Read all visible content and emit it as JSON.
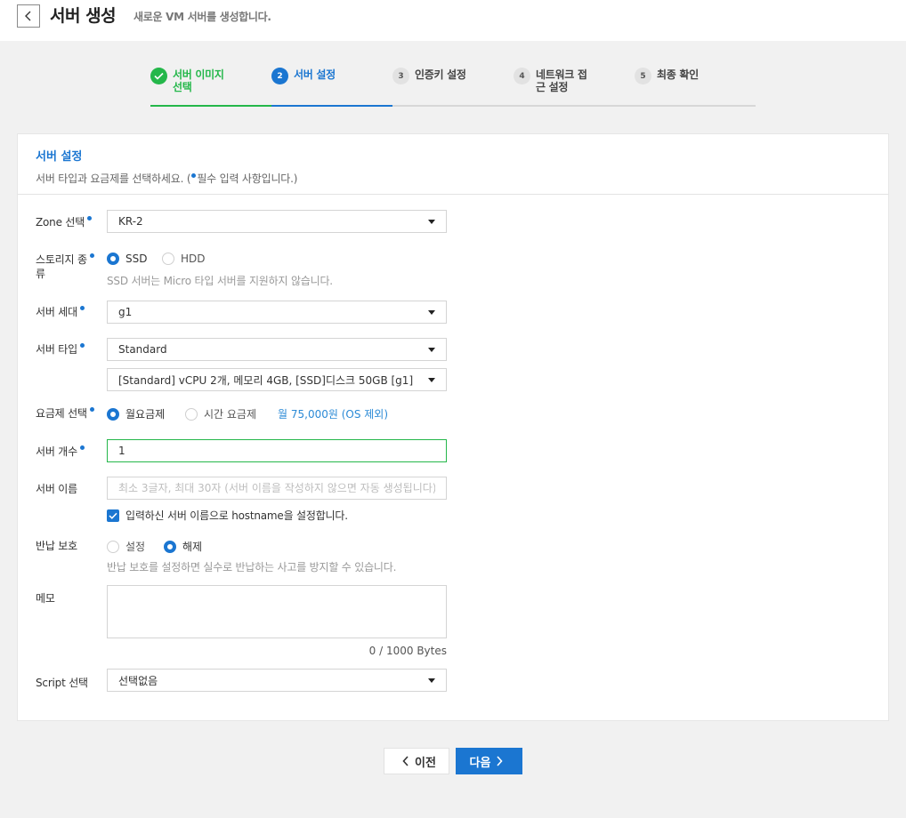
{
  "header": {
    "title": "서버 생성",
    "subtitle": "새로운 VM 서버를 생성합니다."
  },
  "steps": [
    {
      "number": "",
      "label": "서버 이미지\n선택",
      "state": "done"
    },
    {
      "number": "2",
      "label": "서버 설정",
      "state": "active"
    },
    {
      "number": "3",
      "label": "인증키 설정",
      "state": "todo"
    },
    {
      "number": "4",
      "label": "네트워크 접\n근 설정",
      "state": "todo"
    },
    {
      "number": "5",
      "label": "최종 확인",
      "state": "todo"
    }
  ],
  "card": {
    "title": "서버 설정",
    "desc_before": "서버 타입과 요금제를 선택하세요. (",
    "desc_after": "필수 입력 사항입니다.)"
  },
  "form": {
    "zone": {
      "label": "Zone 선택",
      "value": "KR-2"
    },
    "storage": {
      "label": "스토리지 종\n류",
      "options": [
        "SSD",
        "HDD"
      ],
      "selected": "SSD",
      "hint": "SSD 서버는 Micro 타입 서버를 지원하지 않습니다."
    },
    "generation": {
      "label": "서버 세대",
      "value": "g1"
    },
    "server_type": {
      "label": "서버 타입",
      "value": "Standard",
      "spec_value": "[Standard] vCPU 2개, 메모리 4GB, [SSD]디스크 50GB [g1]"
    },
    "plan": {
      "label": "요금제 선택",
      "options": [
        "월요금제",
        "시간 요금제"
      ],
      "selected": "월요금제",
      "price_note": "월 75,000원 (OS 제외)"
    },
    "count": {
      "label": "서버 개수",
      "value": "1"
    },
    "name": {
      "label": "서버 이름",
      "placeholder": "최소 3글자, 최대 30자 (서버 이름을 작성하지 않으면 자동 생성됩니다)",
      "checkbox_label": "입력하신 서버 이름으로 hostname을 설정합니다.",
      "checked": true
    },
    "return_protection": {
      "label": "반납 보호",
      "options": [
        "설정",
        "해제"
      ],
      "selected": "해제",
      "hint": "반납 보호를 설정하면 실수로 반납하는 사고를 방지할 수 있습니다."
    },
    "memo": {
      "label": "메모",
      "value": "",
      "byte_count": "0 / 1000 Bytes"
    },
    "script": {
      "label": "Script 선택",
      "value": "선택없음"
    }
  },
  "buttons": {
    "prev": "이전",
    "next": "다음"
  },
  "colors": {
    "primary": "#1b76d1",
    "success": "#24b74a",
    "price": "#2b8ad6"
  }
}
